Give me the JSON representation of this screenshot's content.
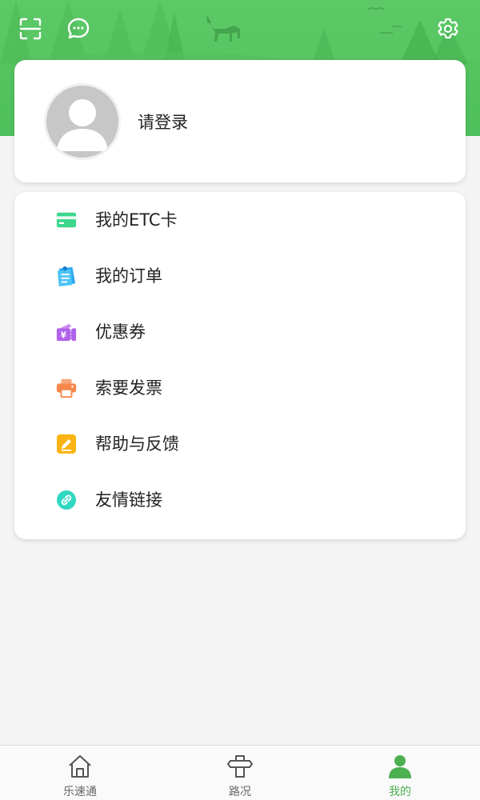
{
  "header": {
    "scan_icon": "scan-icon",
    "message_icon": "chat-bubble-icon",
    "settings_icon": "gear-icon",
    "bg_color": "#56c461"
  },
  "profile": {
    "login_label": "请登录"
  },
  "menu": {
    "items": [
      {
        "label": "我的ETC卡",
        "icon": "card-icon",
        "color": "#3dd68c"
      },
      {
        "label": "我的订单",
        "icon": "order-icon",
        "color": "#2ba8f0"
      },
      {
        "label": "优惠券",
        "icon": "coupon-icon",
        "color": "#b061ea"
      },
      {
        "label": "索要发票",
        "icon": "printer-icon",
        "color": "#f7874a"
      },
      {
        "label": "帮助与反馈",
        "icon": "edit-icon",
        "color": "#fbb414"
      },
      {
        "label": "友情链接",
        "icon": "link-icon",
        "color": "#2fd8c1"
      }
    ]
  },
  "tabbar": {
    "tabs": [
      {
        "label": "乐速通",
        "icon": "home-icon",
        "active": false
      },
      {
        "label": "路况",
        "icon": "signpost-icon",
        "active": false
      },
      {
        "label": "我的",
        "icon": "user-icon",
        "active": true
      }
    ],
    "active_color": "#4caf50"
  }
}
